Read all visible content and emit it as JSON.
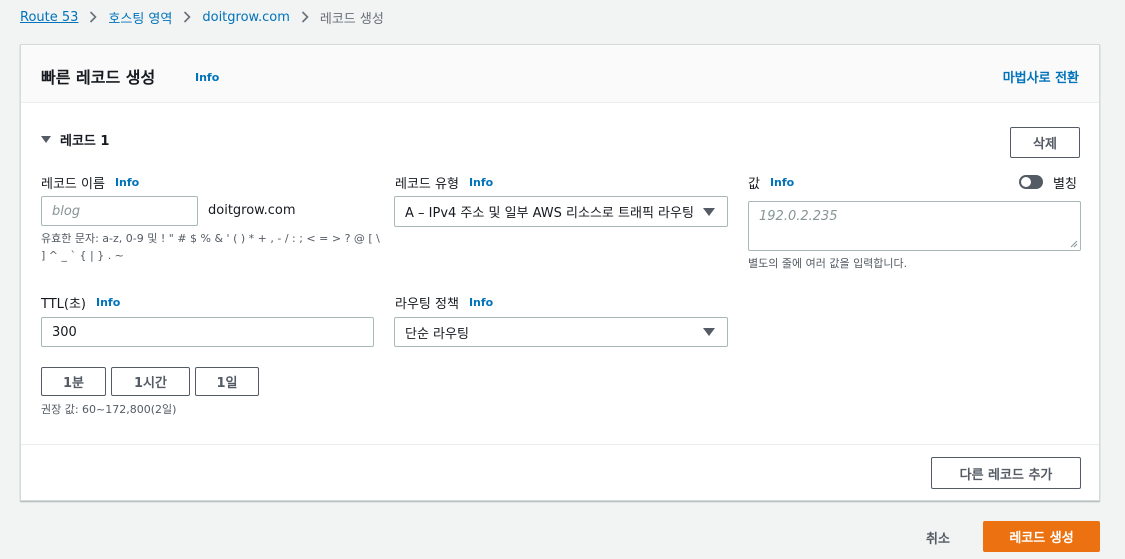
{
  "breadcrumb": {
    "items": [
      "Route 53",
      "호스팅 영역",
      "doitgrow.com"
    ],
    "current": "레코드 생성"
  },
  "panel": {
    "title": "빠른 레코드 생성",
    "info": "Info",
    "wizard_link": "마법사로 전환"
  },
  "record": {
    "section_label": "레코드 1",
    "delete_button": "삭제",
    "name": {
      "label": "레코드 이름",
      "info": "Info",
      "placeholder": "blog",
      "suffix": "doitgrow.com",
      "hint": "유효한 문자: a-z, 0-9 및 ! \" # $ % & ' ( ) * + , - / : ; < = > ? @ [ \\ ] ^ _ ` { | } . ~"
    },
    "type": {
      "label": "레코드 유형",
      "info": "Info",
      "value": "A – IPv4 주소 및 일부 AWS 리소스로 트래픽 라우팅"
    },
    "value": {
      "label": "값",
      "info": "Info",
      "alias_label": "별칭",
      "placeholder": "192.0.2.235",
      "hint": "별도의 줄에 여러 값을 입력합니다."
    },
    "ttl": {
      "label": "TTL(초)",
      "info": "Info",
      "value": "300",
      "presets": [
        "1분",
        "1시간",
        "1일"
      ],
      "hint": "권장 값: 60~172,800(2일)"
    },
    "routing": {
      "label": "라우팅 정책",
      "info": "Info",
      "value": "단순 라우팅"
    }
  },
  "add_record_button": "다른 레코드 추가",
  "footer": {
    "cancel": "취소",
    "create": "레코드 생성"
  },
  "colors": {
    "link": "#0073bb",
    "primary": "#ec7211",
    "background": "#f2f3f3"
  }
}
